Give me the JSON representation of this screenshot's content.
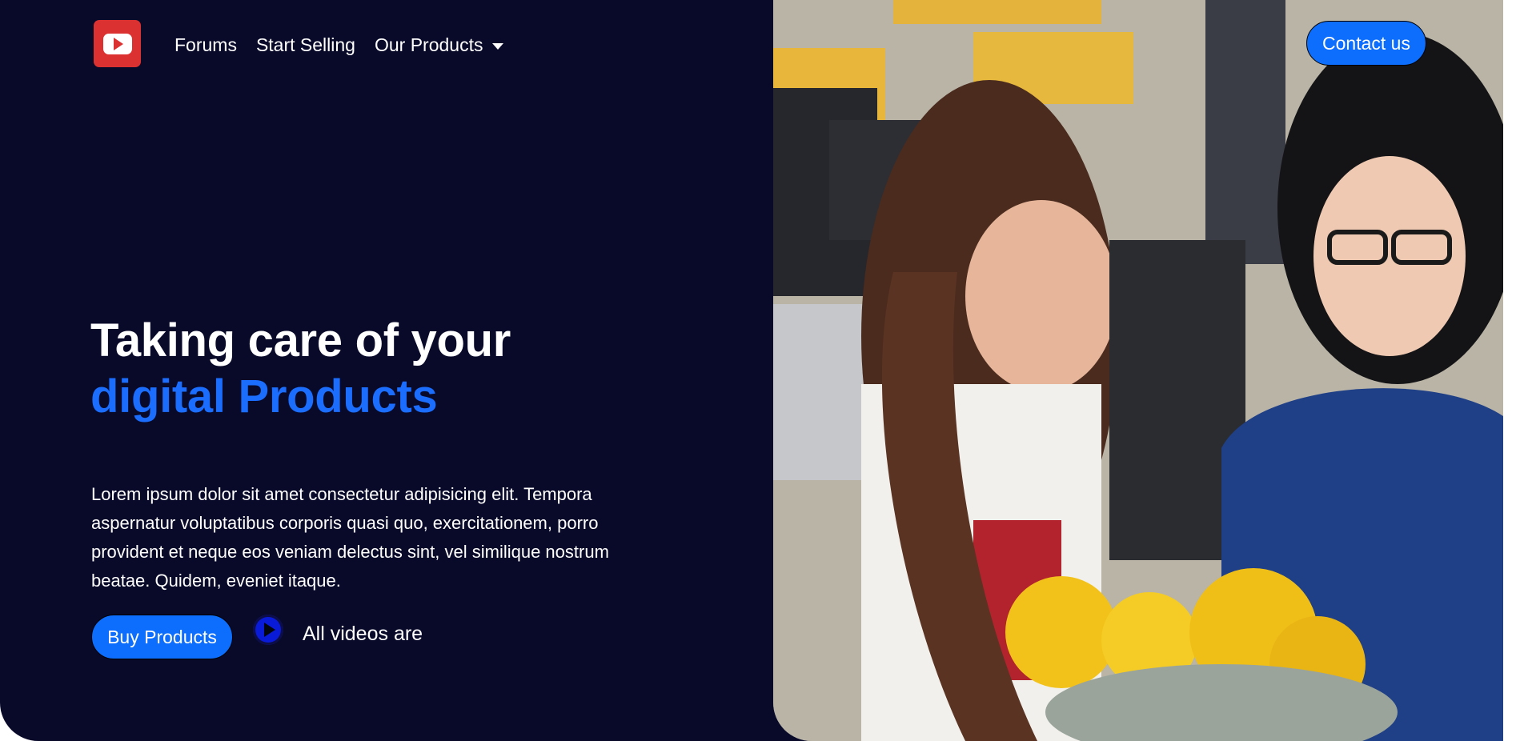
{
  "nav": {
    "logo_icon": "youtube-logo-icon",
    "items": [
      {
        "label": "Forums"
      },
      {
        "label": "Start Selling"
      },
      {
        "label": "Our Products",
        "has_dropdown": true
      }
    ],
    "contact_label": "Contact us"
  },
  "hero": {
    "title_line1": "Taking care of your",
    "title_line2": "digital Products",
    "description": "Lorem ipsum dolor sit amet consectetur adipisicing elit. Tempora aspernatur voluptatibus corporis quasi quo, exercitationem, porro provident et neque eos veniam delectus sint, vel similique nostrum beatae. Quidem, eveniet itaque.",
    "buy_label": "Buy Products",
    "play_icon": "play-circle-icon",
    "videos_label": "All videos are"
  },
  "colors": {
    "background": "#090a2a",
    "accent": "#0d6efd",
    "highlight_text": "#1b6dfd",
    "logo": "#dc3131"
  }
}
